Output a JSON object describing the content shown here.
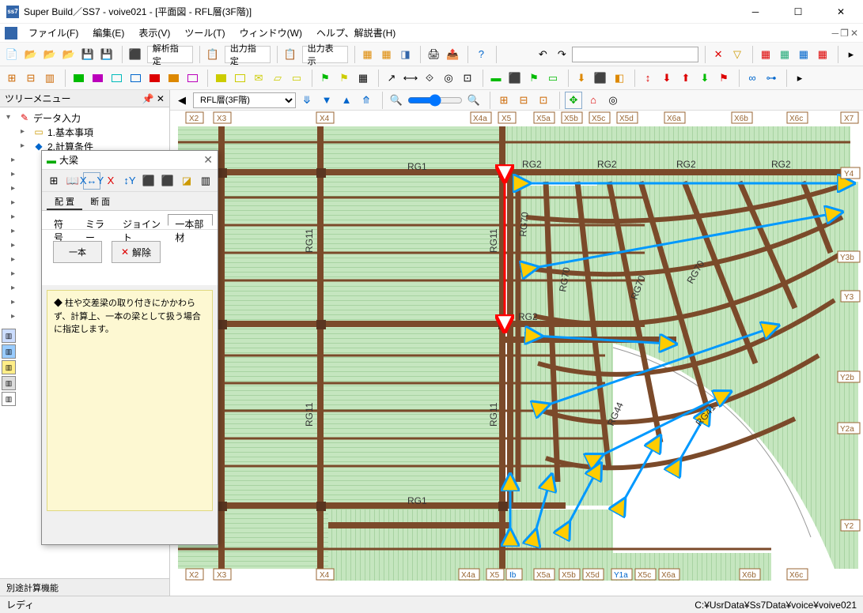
{
  "window": {
    "app_icon": "ss7",
    "title": "Super Build／SS7 - voive021 - [平面図 - RFL層(3F階)]"
  },
  "menu": {
    "file": "ファイル(F)",
    "edit": "編集(E)",
    "view": "表示(V)",
    "tool": "ツール(T)",
    "window": "ウィンドウ(W)",
    "help": "ヘルプ、解説書(H)"
  },
  "toolbar1": {
    "analysis": "解析指定",
    "output_spec": "出力指定",
    "output_view": "出力表示"
  },
  "tree": {
    "header": "ツリーメニュー",
    "root": "データ入力",
    "item1": "1.基本事項",
    "item2": "2.計算条件",
    "bottom": "別途計算機能"
  },
  "canvas": {
    "floor_select": "RFL層(3F階)"
  },
  "popup": {
    "title": "大梁",
    "tab_layout": "配 置",
    "tab_section": "断 面",
    "subtab_sign": "符 号",
    "subtab_mirror": "ミラー",
    "subtab_joint": "ジョイント",
    "subtab_single": "一本部材",
    "btn_single": "一本",
    "btn_cancel": "解除",
    "help": "◆ 柱や交差梁の取り付きにかかわらず、計算上、一本の梁として扱う場合に指定します。"
  },
  "axes": {
    "x": [
      "X2",
      "X3",
      "X4",
      "X4a",
      "X5",
      "X5a",
      "X5b",
      "X5c",
      "X5d",
      "X6a",
      "X6b",
      "X6c",
      "X7"
    ],
    "y": [
      "Y4",
      "Y3b",
      "Y3",
      "Y2b",
      "Y2a",
      "Y2"
    ],
    "x_bottom": [
      "X2",
      "X3",
      "X4",
      "X4a",
      "X5",
      "Ib",
      "X5a",
      "X5b",
      "X5d",
      "Y1a",
      "X5c",
      "X6a",
      "X6b",
      "X6c"
    ]
  },
  "beams": {
    "rg1": "RG1",
    "rg2": "RG2",
    "rg11": "RG11",
    "rg70": "RG70",
    "rg41": "RG41",
    "rg44": "RG44"
  },
  "status": {
    "ready": "レディ",
    "path": "C:¥UsrData¥Ss7Data¥voice¥voive021"
  }
}
